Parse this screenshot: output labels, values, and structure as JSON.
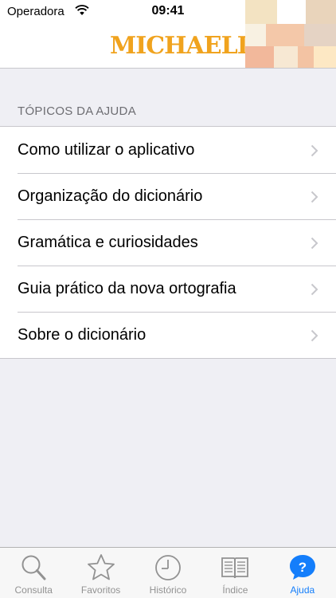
{
  "status_bar": {
    "carrier": "Operadora",
    "time": "09:41"
  },
  "header": {
    "logo_text": "MICHAELIS"
  },
  "help": {
    "section_title": "TÓPICOS DA AJUDA",
    "items": [
      {
        "label": "Como utilizar o aplicativo"
      },
      {
        "label": "Organização do dicionário"
      },
      {
        "label": "Gramática e curiosidades"
      },
      {
        "label": "Guia prático da nova ortografia"
      },
      {
        "label": "Sobre o dicionário"
      }
    ]
  },
  "tabbar": {
    "active_color": "#147efb",
    "inactive_color": "#929292",
    "tabs": [
      {
        "label": "Consulta",
        "icon": "search-icon"
      },
      {
        "label": "Favoritos",
        "icon": "star-icon"
      },
      {
        "label": "Histórico",
        "icon": "clock-icon"
      },
      {
        "label": "Índice",
        "icon": "book-icon"
      },
      {
        "label": "Ajuda",
        "icon": "help-icon",
        "active": true
      }
    ]
  },
  "colors": {
    "logo": "#f0a31e",
    "background": "#efeff4",
    "separator": "#c8c7cc"
  }
}
